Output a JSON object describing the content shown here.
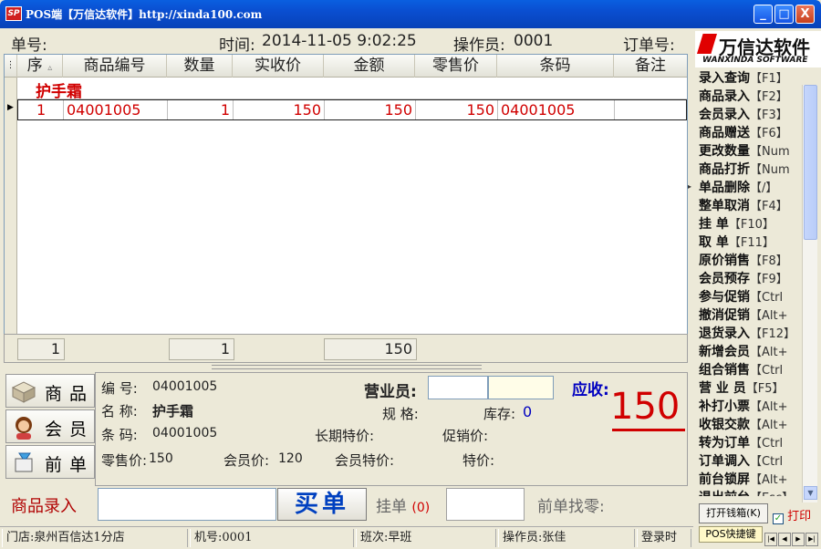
{
  "window": {
    "title": "POS端【万信达软件】http://xinda100.com",
    "icon_text": "SP",
    "controls": [
      "_",
      "□",
      "X"
    ]
  },
  "header": {
    "order_no_label": "单号:",
    "time_label": "时间:",
    "time_value": "2014-11-05 9:02:25",
    "operator_label": "操作员:",
    "operator_value": "0001",
    "order_label": "订单号:"
  },
  "grid": {
    "columns": [
      "序",
      "商品编号",
      "数量",
      "实收价",
      "金额",
      "零售价",
      "条码",
      "备注"
    ],
    "sort_indicator": "▵",
    "group_label": "护手霜",
    "rows": [
      {
        "seq": "1",
        "code": "04001005",
        "qty": "1",
        "price": "150",
        "amount": "150",
        "retail": "150",
        "barcode": "04001005",
        "note": ""
      }
    ],
    "totals": {
      "seq_total": "1",
      "qty_total": "1",
      "amount_total": "150"
    }
  },
  "right_panel": {
    "logo_cn": "万信达软件",
    "logo_en": "WANXINDA SOFTWARE",
    "menu": [
      {
        "label": "录入查询",
        "key": "【F1】"
      },
      {
        "label": "商品录入",
        "key": "【F2】"
      },
      {
        "label": "会员录入",
        "key": "【F3】"
      },
      {
        "label": "商品赠送",
        "key": "【F6】"
      },
      {
        "label": "更改数量",
        "key": "【Num"
      },
      {
        "label": "商品打折",
        "key": "【Num"
      },
      {
        "label": "单品删除",
        "key": "【/】"
      },
      {
        "label": "整单取消",
        "key": "【F4】"
      },
      {
        "label": "挂    单",
        "key": "【F10】"
      },
      {
        "label": "取    单",
        "key": "【F11】"
      },
      {
        "label": "原价销售",
        "key": "【F8】"
      },
      {
        "label": "会员预存",
        "key": "【F9】"
      },
      {
        "label": "参与促销",
        "key": "【Ctrl"
      },
      {
        "label": "撤消促销",
        "key": "【Alt+"
      },
      {
        "label": "退货录入",
        "key": "【F12】"
      },
      {
        "label": "新增会员",
        "key": "【Alt+"
      },
      {
        "label": "组合销售",
        "key": "【Ctrl"
      },
      {
        "label": "营 业 员",
        "key": "【F5】"
      },
      {
        "label": "补打小票",
        "key": "【Alt+"
      },
      {
        "label": "收银交款",
        "key": "【Alt+"
      },
      {
        "label": "转为订单",
        "key": "【Ctrl"
      },
      {
        "label": "订单调入",
        "key": "【Ctrl"
      },
      {
        "label": "前台锁屏",
        "key": "【Alt+"
      },
      {
        "label": "退出前台",
        "key": "【Esc】"
      }
    ],
    "open_drawer_label": "打开钱箱(K)",
    "print_label": "打印",
    "print_checked": true,
    "pos_shortcut_tab": "POS快捷键"
  },
  "product": {
    "tabs": [
      "商品",
      "会员",
      "前单"
    ],
    "code_label": "编  号:",
    "code_value": "04001005",
    "name_label": "名  称:",
    "name_value": "护手霜",
    "barcode_label": "条  码:",
    "barcode_value": "04001005",
    "retail_label": "零售价:",
    "retail_value": "150",
    "member_price_label": "会员价:",
    "member_price_value": "120",
    "member_special_label": "会员特价:",
    "special_label": "特价:",
    "salesperson_label": "营业员:",
    "spec_label": "规  格:",
    "stock_label": "库存:",
    "stock_value": "0",
    "long_special_label": "长期特价:",
    "promo_label": "促销价:",
    "due_label": "应收:",
    "due_value": "150"
  },
  "entry": {
    "label": "商品录入",
    "buy_label": "买单",
    "hold_label": "挂单",
    "hold_count": "(0)",
    "change_label": "前单找零:"
  },
  "statusbar": {
    "store": "门店:泉州百信达1分店",
    "machine": "机号:0001",
    "shift": "班次:早班",
    "operator": "操作员:张佳",
    "login": "登录时"
  },
  "colors": {
    "title_bar": "#0a4ed0",
    "accent_red": "#d00000",
    "accent_blue": "#0000c0",
    "panel_bg": "#ece9d8"
  }
}
